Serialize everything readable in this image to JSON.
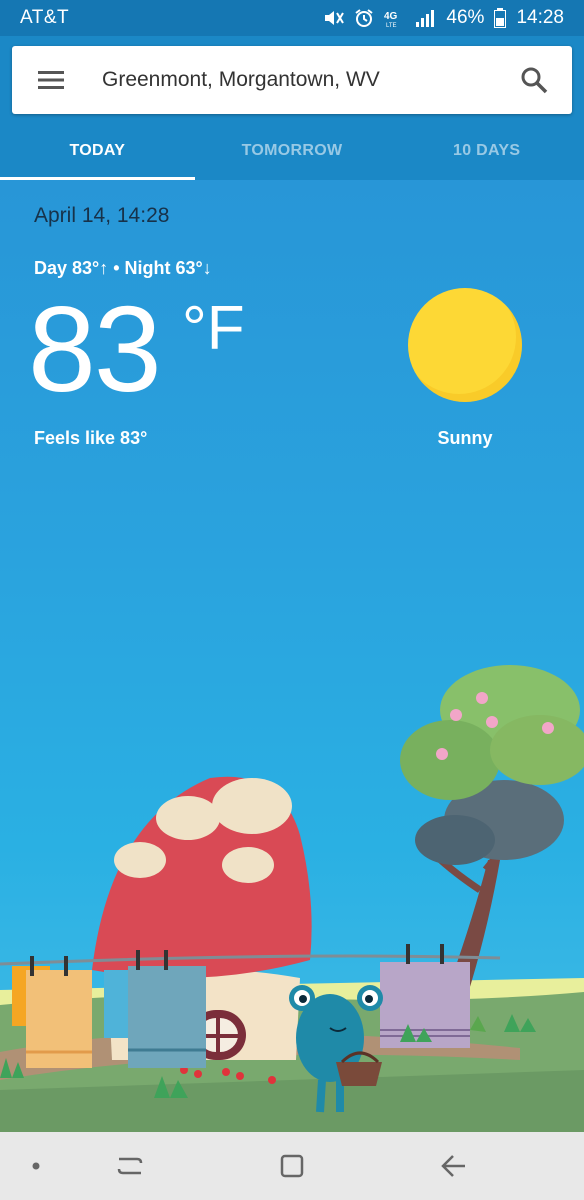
{
  "status_bar": {
    "carrier": "AT&T",
    "network": "4G LTE",
    "battery": "46%",
    "time": "14:28"
  },
  "search": {
    "location": "Greenmont, Morgantown, WV"
  },
  "tabs": [
    {
      "label": "TODAY",
      "active": true
    },
    {
      "label": "TOMORROW",
      "active": false
    },
    {
      "label": "10 DAYS",
      "active": false
    }
  ],
  "weather": {
    "datetime": "April 14, 14:28",
    "day_night": "Day 83°↑ • Night 63°↓",
    "temperature": "83",
    "unit": "°F",
    "feels_like": "Feels like 83°",
    "condition": "Sunny",
    "condition_icon": "sun-icon"
  },
  "colors": {
    "status_bar": "#1577b3",
    "header": "#1b88c6",
    "sky": "#2aa3de",
    "sun": "#fdd835"
  }
}
